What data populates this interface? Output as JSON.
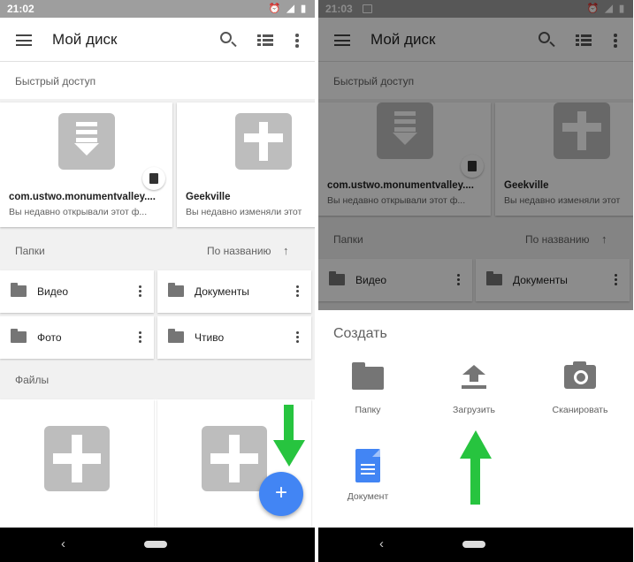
{
  "left": {
    "statusbar": {
      "time": "21:02",
      "icons": "⏰ ◢ ▮"
    },
    "appbar": {
      "title": "Мой диск"
    },
    "quick_access": {
      "label": "Быстрый доступ",
      "cards": [
        {
          "title": "com.ustwo.monumentvalley....",
          "subtitle": "Вы недавно открывали этот ф..."
        },
        {
          "title": "Geekville",
          "subtitle": "Вы недавно изменяли этот"
        }
      ]
    },
    "folders": {
      "label": "Папки",
      "sort_label": "По названию",
      "sort_arrow": "↑",
      "items": [
        "Видео",
        "Документы",
        "Фото",
        "Чтиво"
      ]
    },
    "files": {
      "label": "Файлы"
    },
    "fab_label": "+",
    "nav": {
      "back": "‹"
    }
  },
  "right": {
    "statusbar": {
      "time": "21:03",
      "icons": "⏰ ◢ ▮"
    },
    "appbar": {
      "title": "Мой диск"
    },
    "quick_access": {
      "label": "Быстрый доступ",
      "cards": [
        {
          "title": "com.ustwo.monumentvalley....",
          "subtitle": "Вы недавно открывали этот ф..."
        },
        {
          "title": "Geekville",
          "subtitle": "Вы недавно изменяли этот"
        }
      ]
    },
    "folders": {
      "label": "Папки",
      "sort_label": "По названию",
      "sort_arrow": "↑",
      "items": [
        "Видео",
        "Документы"
      ]
    },
    "sheet": {
      "title": "Создать",
      "items": [
        "Папку",
        "Загрузить",
        "Сканировать",
        "Документ"
      ]
    },
    "nav": {
      "back": "‹"
    }
  },
  "colors": {
    "fab": "#4285f4",
    "annotation_arrow": "#27c43f",
    "docs_icon": "#4285f4"
  }
}
